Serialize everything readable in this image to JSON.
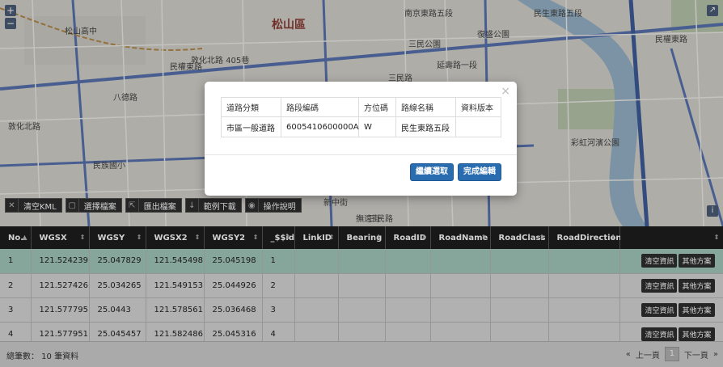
{
  "map": {
    "district": "松山區",
    "labels": [
      "松山高中",
      "復盛公園",
      "南京東路五段",
      "民生東路五段",
      "三民公園",
      "延壽路一段",
      "三民路",
      "敦化北路",
      "民族國小",
      "民權東路",
      "敦化北路 405巷",
      "八德路",
      "撫遠街",
      "彩虹河濱公園",
      "新中街",
      "三民路",
      "民權東路"
    ]
  },
  "map_controls": {
    "zoom_in": "+",
    "zoom_out": "−",
    "info": "i"
  },
  "toolbar": [
    {
      "label": "清空KML",
      "icon": "close-icon"
    },
    {
      "label": "選擇檔案",
      "icon": "file-icon"
    },
    {
      "label": "匯出檔案",
      "icon": "export-icon"
    },
    {
      "label": "範例下載",
      "icon": "download-icon"
    },
    {
      "label": "操作說明",
      "icon": "help-icon"
    }
  ],
  "grid": {
    "columns": [
      "No.",
      "WGSX",
      "WGSY",
      "WGSX2",
      "WGSY2",
      "_$$id",
      "LinkID",
      "Bearing",
      "RoadID",
      "RoadName",
      "RoadClass",
      "RoadDirection",
      ""
    ],
    "rows": [
      {
        "no": "1",
        "wgsx": "121.524239",
        "wgsy": "25.047829",
        "wgsx2": "121.545498",
        "wgsy2": "25.045198",
        "id": "1",
        "selected": true
      },
      {
        "no": "2",
        "wgsx": "121.527426",
        "wgsy": "25.034265",
        "wgsx2": "121.549153",
        "wgsy2": "25.044926",
        "id": "2",
        "selected": false
      },
      {
        "no": "3",
        "wgsx": "121.577795",
        "wgsy": "25.0443",
        "wgsx2": "121.578561",
        "wgsy2": "25.036468",
        "id": "3",
        "selected": false
      },
      {
        "no": "4",
        "wgsx": "121.577951",
        "wgsy": "25.045457",
        "wgsx2": "121.582486",
        "wgsy2": "25.045316",
        "id": "4",
        "selected": false
      }
    ],
    "row_actions": {
      "clear": "清空資訊",
      "other": "其他方案"
    }
  },
  "footer": {
    "count_text": "總筆數： 10 筆資料",
    "prev": "上一頁",
    "page": "1",
    "next": "下一頁"
  },
  "modal": {
    "headers": [
      "道路分類",
      "路段編碼",
      "方位碼",
      "路線名稱",
      "資料版本"
    ],
    "row": [
      "市區一般道路",
      "6005410600000A",
      "W",
      "民生東路五段",
      ""
    ],
    "continue_label": "繼續選取",
    "finish_label": "完成編輯",
    "close": "×"
  },
  "colors": {
    "accent": "#2a6cb0",
    "selected_row": "#a4cabd",
    "header_bg": "#1e1e1e"
  }
}
